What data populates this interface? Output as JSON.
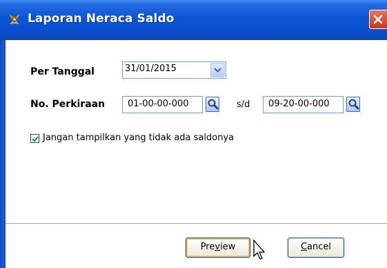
{
  "window": {
    "title": "Laporan Neraca Saldo",
    "icon": "report-icon"
  },
  "form": {
    "per_tanggal_label": "Per Tanggal",
    "date_value": "31/01/2015",
    "no_perkiraan_label": "No. Perkiraan",
    "account_from": "01-00-00-000",
    "sd_label": "s/d",
    "account_to": "09-20-00-000",
    "checkbox_checked": true,
    "checkbox_label": "Jangan tampilkan yang tidak ada saldonya"
  },
  "buttons": {
    "preview_pre": "Pre",
    "preview_u": "v",
    "preview_post": "iew",
    "cancel_u": "C",
    "cancel_post": "ancel"
  },
  "colors": {
    "title_bar": "#0a56d6",
    "close": "#c7391d",
    "dialog_bg": "#ece9d8",
    "border": "#7f9db9"
  }
}
